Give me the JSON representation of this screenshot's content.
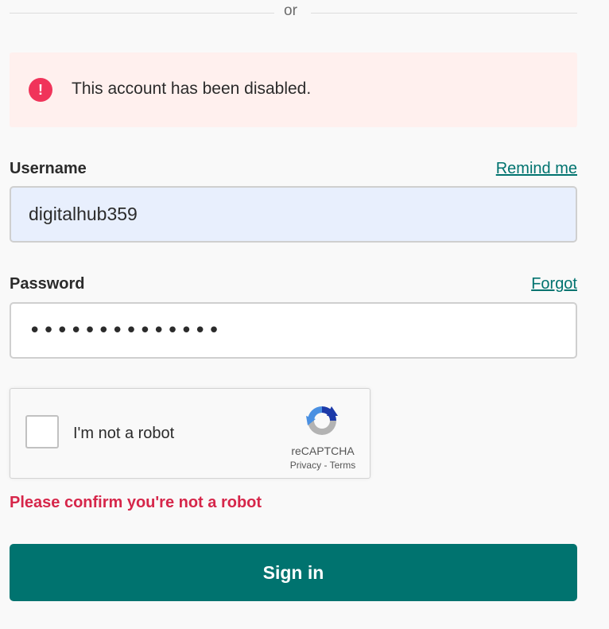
{
  "divider": {
    "text": "or"
  },
  "alert": {
    "icon": "exclamation-icon",
    "message": "This account has been disabled.",
    "colors": {
      "background": "#fff0ee",
      "icon": "#f0345a"
    }
  },
  "username": {
    "label": "Username",
    "link": "Remind me",
    "value": "digitalhub359"
  },
  "password": {
    "label": "Password",
    "link": "Forgot",
    "value": "••••••••••••••"
  },
  "captcha": {
    "label": "I'm not a robot",
    "brand": "reCAPTCHA",
    "privacy": "Privacy",
    "separator": "-",
    "terms": "Terms",
    "checked": false
  },
  "error": {
    "message": "Please confirm you're not a robot",
    "color": "#d6264a"
  },
  "signin": {
    "label": "Sign in",
    "color": "#00736f"
  }
}
